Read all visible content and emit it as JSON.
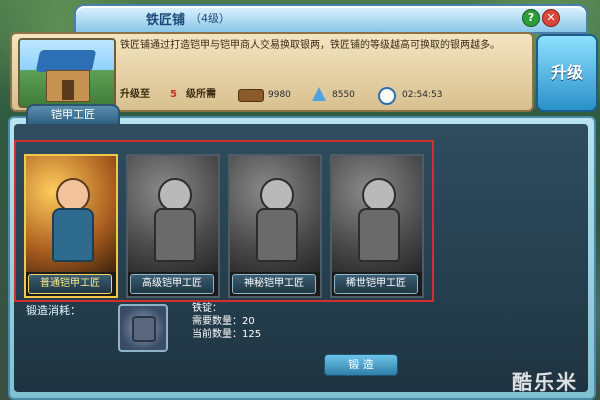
{
  "window": {
    "title": "铁匠铺",
    "level": "（4级）",
    "help_label": "?",
    "close_label": "✕"
  },
  "info": {
    "description": "铁匠铺通过打造铠甲与铠甲商人交易换取银两，铁匠铺的等级越高可换取的银两越多。",
    "upgrade_to_label": "升级至",
    "upgrade_to_value": "5",
    "required_label": "级所需",
    "wood": "9980",
    "crystal": "8550",
    "time": "02:54:53",
    "upgrade_button": "升级"
  },
  "panel": {
    "tab_label": "铠甲工匠",
    "craftsmen": [
      {
        "name": "普通铠甲工匠",
        "active": true
      },
      {
        "name": "高级铠甲工匠",
        "active": false
      },
      {
        "name": "神秘铠甲工匠",
        "active": false
      },
      {
        "name": "稀世铠甲工匠",
        "active": false
      }
    ],
    "forge_cost_label": "锻造消耗：",
    "material": {
      "name": "铁锭：",
      "required": "需要数量：20",
      "current": "当前数量：125"
    },
    "forge_button": "锻 造"
  },
  "watermark": "酷乐米",
  "colors": {
    "highlight_frame": "#d12e2e",
    "active_card_border": "#f0c94a",
    "level_number": "#c0352a"
  }
}
